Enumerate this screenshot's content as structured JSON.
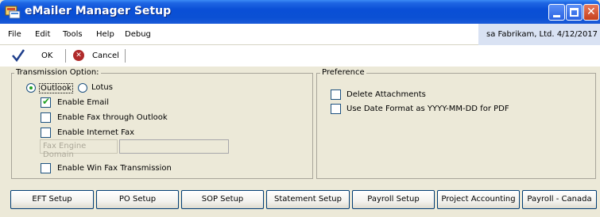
{
  "window": {
    "title": "eMailer Manager Setup",
    "title_bar_color": "#0b50d4"
  },
  "menu": {
    "items": [
      "File",
      "Edit",
      "Tools",
      "Help",
      "Debug"
    ],
    "status": "sa  Fabrikam, Ltd.  4/12/2017"
  },
  "toolbar": {
    "ok_label": "OK",
    "cancel_label": "Cancel"
  },
  "transmission": {
    "title": "Transmission Option:",
    "radio_outlook": "Outlook",
    "radio_lotus": "Lotus",
    "selected": "Outlook",
    "enable_email": {
      "label": "Enable Email",
      "checked": true
    },
    "enable_fax_outlook": {
      "label": "Enable Fax through Outlook",
      "checked": false
    },
    "enable_internet_fax": {
      "label": "Enable Internet Fax",
      "checked": false
    },
    "fax_engine_domain_label": "Fax Engine Domain",
    "fax_engine_domain_value": "",
    "enable_win_fax": {
      "label": "Enable Win Fax Transmission",
      "checked": false
    }
  },
  "preference": {
    "title": "Preference",
    "delete_attachments": {
      "label": "Delete Attachments",
      "checked": false
    },
    "date_format": {
      "label": "Use Date Format as YYYY-MM-DD for PDF",
      "checked": false
    }
  },
  "bottom_buttons": [
    "EFT Setup",
    "PO Setup",
    "SOP Setup",
    "Statement Setup",
    "Payroll Setup",
    "Project Accounting",
    "Payroll - Canada"
  ],
  "colors": {
    "check_green": "#21a121",
    "cancel_red": "#b02a2a",
    "window_bg": "#ece9d8"
  }
}
